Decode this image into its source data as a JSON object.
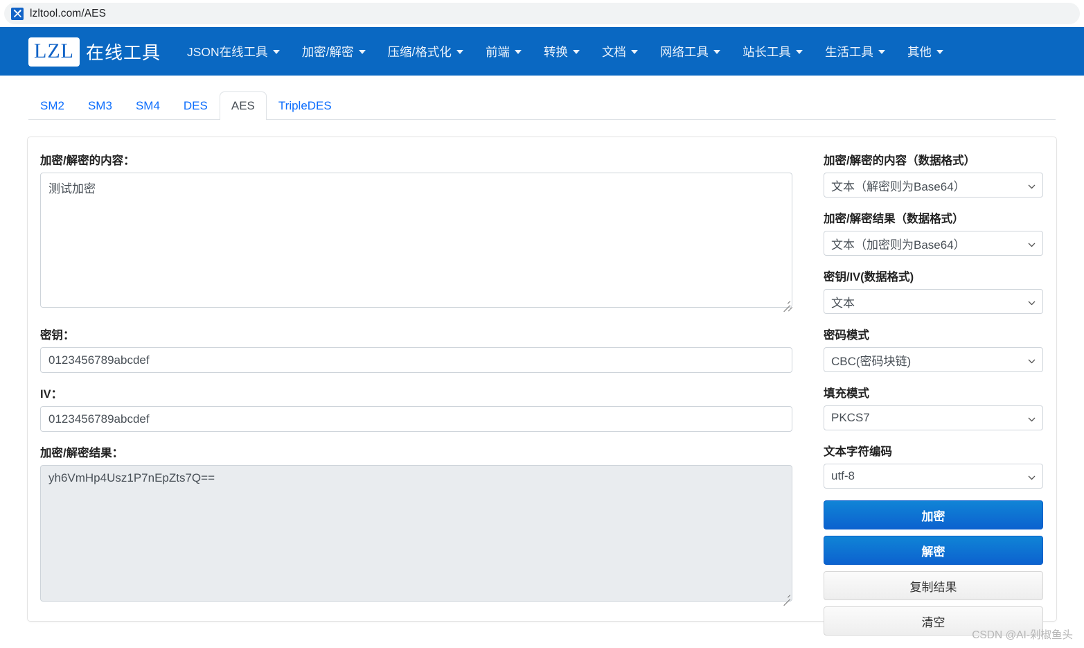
{
  "browser": {
    "favicon_name": "tools-favicon",
    "url": "lzltool.com/AES"
  },
  "header": {
    "logo_text": "LZL",
    "brand_text": "在线工具",
    "nav_items": [
      {
        "label": "JSON在线工具",
        "has_dropdown": true
      },
      {
        "label": "加密/解密",
        "has_dropdown": true
      },
      {
        "label": "压缩/格式化",
        "has_dropdown": true
      },
      {
        "label": "前端",
        "has_dropdown": true
      },
      {
        "label": "转换",
        "has_dropdown": true
      },
      {
        "label": "文档",
        "has_dropdown": true
      },
      {
        "label": "网络工具",
        "has_dropdown": true
      },
      {
        "label": "站长工具",
        "has_dropdown": true
      },
      {
        "label": "生活工具",
        "has_dropdown": true
      },
      {
        "label": "其他",
        "has_dropdown": true
      }
    ],
    "bg_color": "#0a68c2"
  },
  "tabs": {
    "items": [
      {
        "label": "SM2",
        "active": false
      },
      {
        "label": "SM3",
        "active": false
      },
      {
        "label": "SM4",
        "active": false
      },
      {
        "label": "DES",
        "active": false
      },
      {
        "label": "AES",
        "active": true
      },
      {
        "label": "TripleDES",
        "active": false
      }
    ],
    "active_index": 4
  },
  "form": {
    "content_label": "加密/解密的内容：",
    "content_value": "测试加密",
    "key_label": "密钥：",
    "key_value": "0123456789abcdef",
    "iv_label": "IV：",
    "iv_value": "0123456789abcdef",
    "result_label": "加密/解密结果：",
    "result_value": "yh6VmHp4Usz1P7nEpZts7Q=="
  },
  "options": {
    "fields": [
      {
        "label": "加密/解密的内容（数据格式）",
        "value": "文本（解密则为Base64）",
        "name": "content-format-select"
      },
      {
        "label": "加密/解密结果（数据格式）",
        "value": "文本（加密则为Base64）",
        "name": "result-format-select"
      },
      {
        "label": "密钥/IV(数据格式)",
        "value": "文本",
        "name": "key-iv-format-select"
      },
      {
        "label": "密码模式",
        "value": "CBC(密码块链)",
        "name": "cipher-mode-select"
      },
      {
        "label": "填充模式",
        "value": "PKCS7",
        "name": "padding-mode-select"
      },
      {
        "label": "文本字符编码",
        "value": "utf-8",
        "name": "charset-select"
      }
    ],
    "buttons": [
      {
        "label": "加密",
        "style": "primary",
        "name": "encrypt-button"
      },
      {
        "label": "解密",
        "style": "primary",
        "name": "decrypt-button"
      },
      {
        "label": "复制结果",
        "style": "default",
        "name": "copy-result-button"
      },
      {
        "label": "清空",
        "style": "default",
        "name": "clear-button"
      }
    ]
  },
  "watermark": {
    "text": "CSDN @AI-剁椒鱼头"
  },
  "colors": {
    "brand_blue": "#0a68c2",
    "link_blue": "#0d6efd",
    "button_blue_top": "#1084d6",
    "button_blue_bottom": "#0c62cf",
    "readonly_bg": "#e9ecef"
  }
}
